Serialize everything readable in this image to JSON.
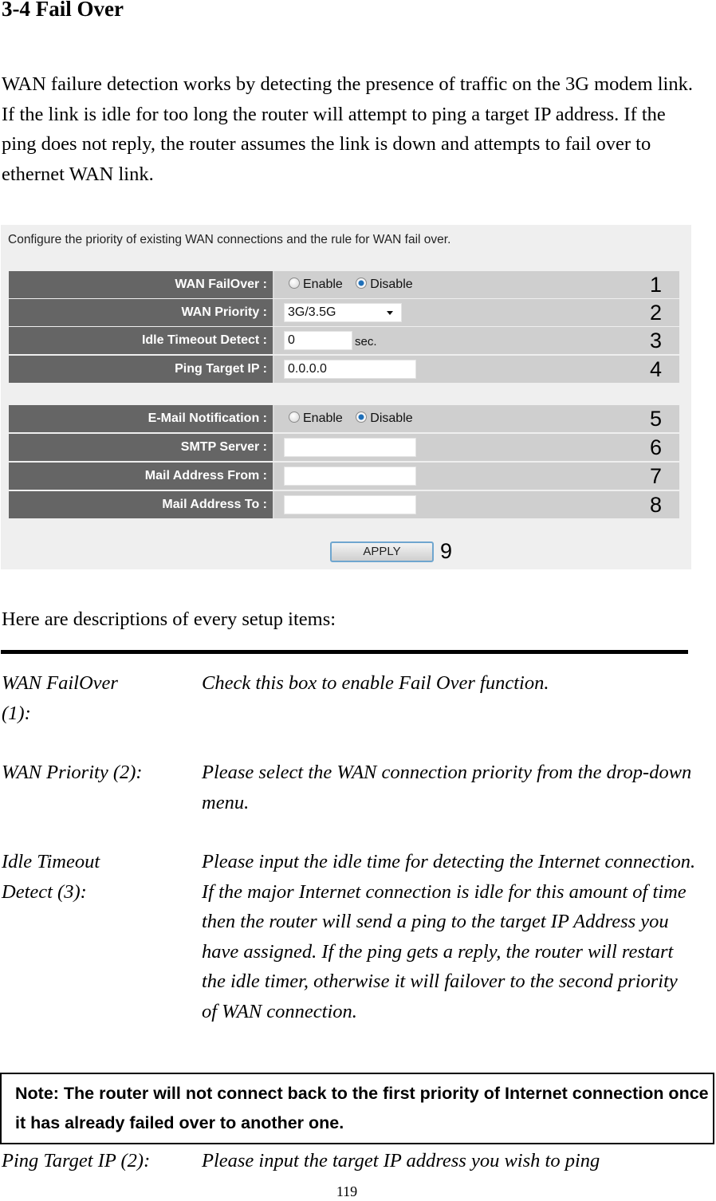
{
  "section_title": "3-4 Fail Over",
  "intro_paragraph": "WAN failure detection works by detecting the presence of traffic on the 3G modem link. If the link is idle for too long the router will attempt to ping a target IP address. If the ping does not reply, the router assumes the link is down and attempts to fail over to ethernet WAN link.",
  "screenshot": {
    "caption": "Configure the priority of existing WAN connections and the rule for WAN fail over.",
    "wan_failover": {
      "label": "WAN FailOver :",
      "options": [
        "Enable",
        "Disable"
      ],
      "selected": "Disable",
      "marker": "1"
    },
    "wan_priority": {
      "label": "WAN Priority :",
      "value": "3G/3.5G",
      "marker": "2"
    },
    "idle_timeout": {
      "label": "Idle Timeout Detect :",
      "value": "0",
      "unit": "sec.",
      "marker": "3"
    },
    "ping_target": {
      "label": "Ping Target IP :",
      "value": "0.0.0.0",
      "marker": "4"
    },
    "email_notification": {
      "label": "E-Mail Notification :",
      "options": [
        "Enable",
        "Disable"
      ],
      "selected": "Disable",
      "marker": "5"
    },
    "smtp_server": {
      "label": "SMTP Server :",
      "value": "",
      "marker": "6"
    },
    "mail_from": {
      "label": "Mail Address From :",
      "value": "",
      "marker": "7"
    },
    "mail_to": {
      "label": "Mail Address To :",
      "value": "",
      "marker": "8"
    },
    "apply": {
      "label": "APPLY",
      "marker": "9"
    }
  },
  "descriptions_intro": "Here are descriptions of every setup items:",
  "descriptions": [
    {
      "term": "WAN FailOver (1):",
      "definition": "Check this box to enable Fail Over function."
    },
    {
      "term": "WAN Priority (2):",
      "definition": "Please select the WAN connection priority from the drop-down menu."
    },
    {
      "term": "Idle Timeout Detect (3):",
      "definition": "Please input the idle time for detecting the Internet connection. If the major Internet connection is idle for this amount of time then the router will send a ping to the target IP Address you have assigned. If the ping gets a reply, the router will restart the idle timer, otherwise it will failover to the second priority of WAN connection."
    },
    {
      "term": "Ping Target IP (2):",
      "definition": "Please input the target IP address you wish to ping"
    }
  ],
  "note": "Note: The router will not connect back to the first priority of Internet connection once it has already failed over to another one.",
  "page_number": "119"
}
